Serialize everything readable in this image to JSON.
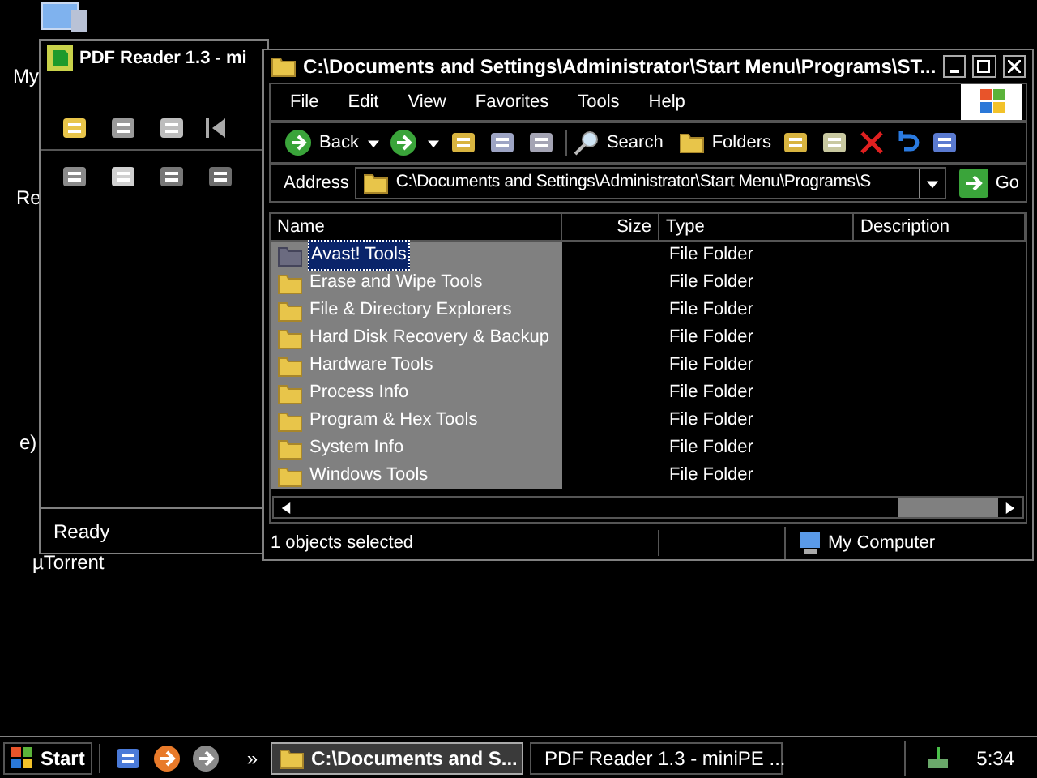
{
  "desktop_icons": [
    {
      "label": "My"
    },
    {
      "label": "Re"
    },
    {
      "label": "e)"
    },
    {
      "label": "µTorrent"
    }
  ],
  "pdf_window": {
    "title": "PDF Reader 1.3 - mi",
    "status": "Ready"
  },
  "explorer": {
    "title": "C:\\Documents and Settings\\Administrator\\Start Menu\\Programs\\ST...",
    "menu": [
      "File",
      "Edit",
      "View",
      "Favorites",
      "Tools",
      "Help"
    ],
    "toolbar": {
      "back": "Back",
      "search": "Search",
      "folders": "Folders"
    },
    "address": {
      "label": "Address",
      "value": "C:\\Documents and Settings\\Administrator\\Start Menu\\Programs\\S",
      "go": "Go"
    },
    "columns": [
      "Name",
      "Size",
      "Type",
      "Description"
    ],
    "rows": [
      {
        "name": "Avast! Tools",
        "type": "File Folder",
        "selected": true
      },
      {
        "name": "Erase and Wipe Tools",
        "type": "File Folder",
        "selected": false
      },
      {
        "name": "File & Directory Explorers",
        "type": "File Folder",
        "selected": false
      },
      {
        "name": "Hard Disk Recovery & Backup",
        "type": "File Folder",
        "selected": false
      },
      {
        "name": "Hardware Tools",
        "type": "File Folder",
        "selected": false
      },
      {
        "name": "Process Info",
        "type": "File Folder",
        "selected": false
      },
      {
        "name": "Program & Hex Tools",
        "type": "File Folder",
        "selected": false
      },
      {
        "name": "System Info",
        "type": "File Folder",
        "selected": false
      },
      {
        "name": "Windows Tools",
        "type": "File Folder",
        "selected": false
      }
    ],
    "status": {
      "selection": "1 objects selected",
      "zone": "My Computer"
    }
  },
  "taskbar": {
    "start": "Start",
    "chevron": "»",
    "tasks": [
      {
        "label": "C:\\Documents and S...",
        "selected": true
      },
      {
        "label": "PDF Reader 1.3 - miniPE ...",
        "selected": false
      }
    ],
    "clock": "5:34"
  }
}
